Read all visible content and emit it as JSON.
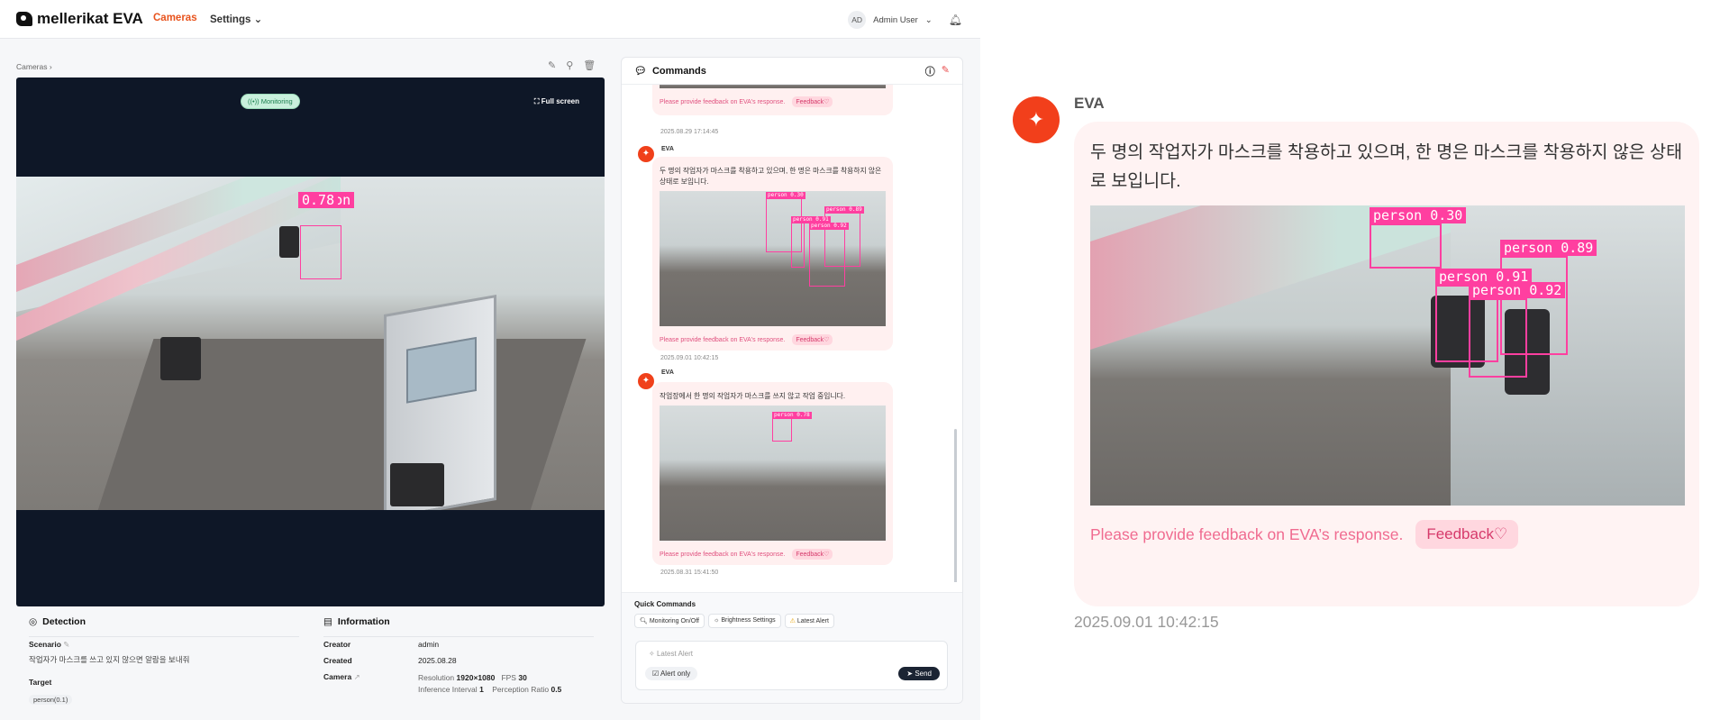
{
  "app": {
    "brand": "mellerikat EVA"
  },
  "nav": {
    "cameras": "Cameras",
    "settings": "Settings"
  },
  "user": {
    "initials": "AD",
    "name": "Admin User"
  },
  "breadcrumb": {
    "label": "Cameras"
  },
  "video": {
    "status_pill": "Monitoring",
    "fullscreen_label": "Full screen",
    "detection": {
      "label": "person",
      "score": "0.78"
    }
  },
  "detection": {
    "title": "Detection",
    "scenario_label": "Scenario",
    "scenario_text": "작업자가 마스크를 쓰고 있지 않으면 알람을 보내줘",
    "target_label": "Target",
    "target_value": "person(0.1)"
  },
  "information": {
    "title": "Information",
    "creator_label": "Creator",
    "creator_value": "admin",
    "created_label": "Created",
    "created_value": "2025.08.28",
    "camera_label": "Camera",
    "resolution_label": "Resolution",
    "resolution_value": "1920×1080",
    "fps_label": "FPS",
    "fps_value": "30",
    "interval_label": "Inference Interval",
    "interval_value": "1",
    "ratio_label": "Perception Ratio",
    "ratio_value": "0.5"
  },
  "commands": {
    "title": "Commands",
    "feedback_prompt": "Please provide feedback on EVA's response.",
    "feedback_button": "Feedback",
    "messages": [
      {
        "timestamp": "2025.08.29 17:14:45"
      },
      {
        "author": "EVA",
        "text": "두 명의 작업자가 마스크를 착용하고 있으며, 한 명은 마스크를 착용하지 않은 상태로 보입니다.",
        "timestamp": "2025.09.01 10:42:15",
        "boxes": [
          {
            "label": "person 0.30"
          },
          {
            "label": "person 0.89"
          },
          {
            "label": "person 0.91"
          },
          {
            "label": "person 0.92"
          }
        ]
      },
      {
        "author": "EVA",
        "text": "작업장에서 한 명의 작업자가 마스크를 쓰지 않고 작업 중입니다.",
        "timestamp": "2025.08.31 15:41:50",
        "boxes": [
          {
            "label": "person 0.78"
          }
        ]
      }
    ]
  },
  "quick_commands": {
    "title": "Quick Commands",
    "chips": [
      "Monitoring On/Off",
      "Brightness Settings",
      "Latest Alert"
    ],
    "input_placeholder": "Latest Alert",
    "alert_only": "Alert only",
    "send": "Send"
  },
  "zoom": {
    "author": "EVA",
    "text": "두 명의 작업자가 마스크를 착용하고 있으며, 한 명은 마스크를 착용하지 않은 상태로 보입니다.",
    "feedback_prompt": "Please provide feedback on EVA’s response.",
    "feedback_button": "Feedback",
    "timestamp": "2025.09.01 10:42:15",
    "boxes": [
      {
        "label": "person 0.30"
      },
      {
        "label": "person 0.89"
      },
      {
        "label": "person 0.91"
      },
      {
        "label": "person 0.92"
      }
    ]
  },
  "colors": {
    "accent": "#e8531d",
    "eva": "#f0401a",
    "bbox": "#ff3fa0",
    "video_bg": "#0e1727"
  }
}
